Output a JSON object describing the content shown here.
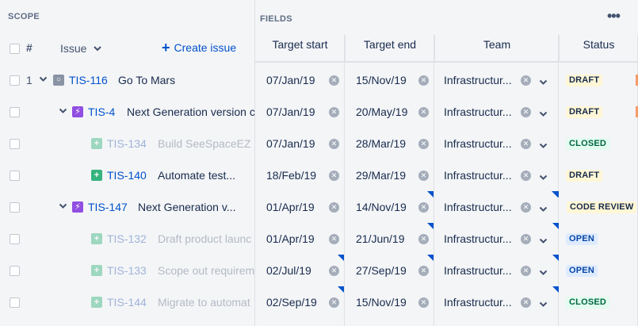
{
  "scope": {
    "title": "SCOPE",
    "hash_label": "#",
    "issue_label": "Issue",
    "create_issue_label": "Create issue"
  },
  "fields": {
    "title": "FIELDS",
    "more_label": "•••",
    "columns": [
      "Target start",
      "Target end",
      "Team",
      "Status"
    ]
  },
  "colors": {
    "link": "#0052CC",
    "epic": "#904EE2",
    "story": "#36B37E",
    "initiative": "#8993A4",
    "flag": "#0052CC"
  },
  "rows": [
    {
      "num": "1",
      "icon": "initiative-icon",
      "key": "TIS-116",
      "title": "Go To Mars",
      "start": "07/Jan/19",
      "end": "15/Nov/19",
      "team": "Infrastructur...",
      "status": "DRAFT",
      "edge": "#F79A6B"
    },
    {
      "num": "",
      "icon": "epic-icon",
      "key": "TIS-4",
      "title": "Next Generation version c",
      "start": "07/Jan/19",
      "end": "20/May/19",
      "team": "Infrastructur...",
      "status": "DRAFT",
      "edge": "#F79A6B"
    },
    {
      "num": "",
      "icon": "story-icon",
      "key": "TIS-134",
      "title": "Build SeeSpaceEZ",
      "start": "07/Jan/19",
      "end": "28/Mar/19",
      "team": "Infrastructur...",
      "status": "CLOSED"
    },
    {
      "num": "",
      "icon": "story-icon",
      "key": "TIS-140",
      "title": "Automate test...",
      "start": "18/Feb/19",
      "end": "29/Mar/19",
      "team": "Infrastructur...",
      "status": "DRAFT"
    },
    {
      "num": "",
      "icon": "epic-icon",
      "key": "TIS-147",
      "title": "Next Generation v...",
      "start": "01/Apr/19",
      "end": "14/Nov/19",
      "team": "Infrastructur...",
      "status": "CODE REVIEW"
    },
    {
      "num": "",
      "icon": "story-icon",
      "key": "TIS-132",
      "title": "Draft product launc",
      "start": "01/Apr/19",
      "end": "21/Jun/19",
      "team": "Infrastructur...",
      "status": "OPEN"
    },
    {
      "num": "",
      "icon": "story-icon",
      "key": "TIS-133",
      "title": "Scope out requirem",
      "start": "02/Jul/19",
      "end": "27/Sep/19",
      "team": "Infrastructur...",
      "status": "OPEN"
    },
    {
      "num": "",
      "icon": "story-icon",
      "key": "TIS-144",
      "title": "Migrate to automat",
      "start": "02/Sep/19",
      "end": "15/Nov/19",
      "team": "Infrastructur...",
      "status": "CLOSED"
    }
  ]
}
